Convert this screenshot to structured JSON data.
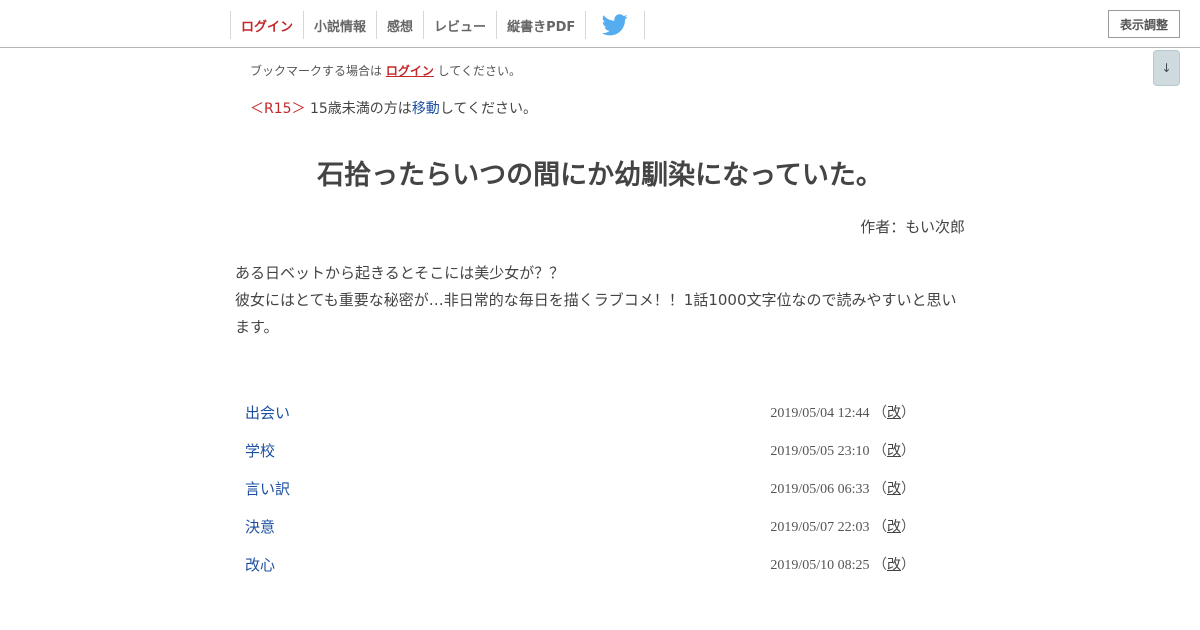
{
  "nav": {
    "login": "ログイン",
    "novel_info": "小説情報",
    "impressions": "感想",
    "review": "レビュー",
    "vertical_pdf": "縦書きPDF"
  },
  "display_settings": "表示調整",
  "scroll_button": "↓",
  "bookmark_note": {
    "before": "ブックマークする場合は ",
    "link": "ログイン",
    "after": " してください。"
  },
  "r15_note": {
    "tag": "＜R15＞",
    "before": " 15歳未満の方は",
    "link": "移動",
    "after": "してください。"
  },
  "novel": {
    "title": "石拾ったらいつの間にか幼馴染になっていた。",
    "author": "作者：もい次郎",
    "summary_line1": "ある日ベットから起きるとそこには美少女が？？",
    "summary_line2": "彼女にはとても重要な秘密が…非日常的な毎日を描くラブコメ！！1話1000文字位なので読みやすいと思います。"
  },
  "chapters": [
    {
      "title": "出会い",
      "date": "2019/05/04 12:44",
      "revised": "改"
    },
    {
      "title": "学校",
      "date": "2019/05/05 23:10",
      "revised": "改"
    },
    {
      "title": "言い訳",
      "date": "2019/05/06 06:33",
      "revised": "改"
    },
    {
      "title": "決意",
      "date": "2019/05/07 22:03",
      "revised": "改"
    },
    {
      "title": "改心",
      "date": "2019/05/10 08:25",
      "revised": "改"
    }
  ],
  "colors": {
    "accent_red": "#c1282a",
    "link_blue": "#1e50a2",
    "twitter_blue": "#55acee"
  },
  "icons": {
    "twitter": "twitter-bird-icon"
  }
}
